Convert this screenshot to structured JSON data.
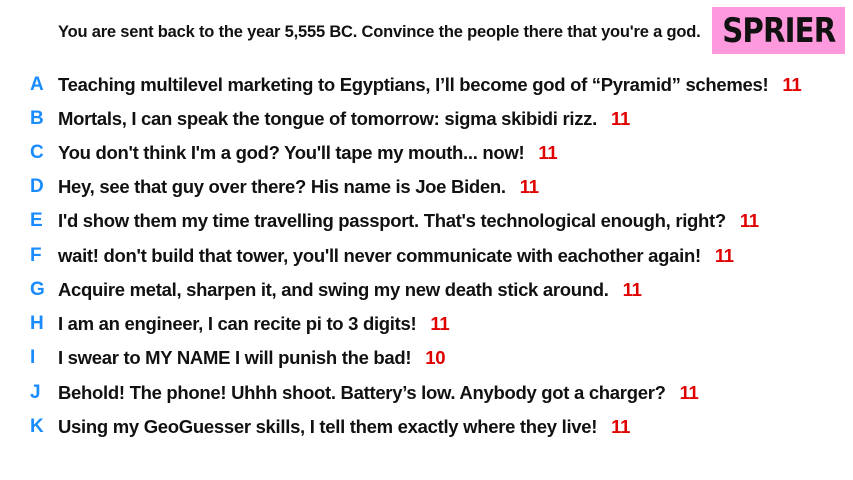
{
  "prompt": "You are sent back to the year 5,555 BC. Convince the people there that you're a god.",
  "badge": "SPRIER",
  "answers": [
    {
      "letter": "A",
      "text": "Teaching multilevel marketing to Egyptians, I’ll become god of “Pyramid” schemes!",
      "score": "11"
    },
    {
      "letter": "B",
      "text": "Mortals, I can speak the tongue of tomorrow: sigma skibidi rizz.",
      "score": "11"
    },
    {
      "letter": "C",
      "text": "You don't think I'm a god? You'll tape my mouth... now!",
      "score": "11"
    },
    {
      "letter": "D",
      "text": "Hey, see that guy over there? His name is Joe Biden.",
      "score": "11"
    },
    {
      "letter": "E",
      "text": "I'd show them my time travelling passport. That's technological enough, right?",
      "score": "11"
    },
    {
      "letter": "F",
      "text": "wait! don't build that tower, you'll never communicate with eachother again!",
      "score": "11"
    },
    {
      "letter": "G",
      "text": "Acquire metal, sharpen it, and swing my new death stick around.",
      "score": "11"
    },
    {
      "letter": "H",
      "text": "I am an engineer, I can recite pi to 3 digits!",
      "score": "11"
    },
    {
      "letter": "I",
      "text": "I swear to MY NAME I will punish the bad!",
      "score": "10"
    },
    {
      "letter": "J",
      "text": "Behold! The phone! Uhhh shoot. Battery’s low. Anybody got a charger?",
      "score": "11"
    },
    {
      "letter": "K",
      "text": "Using my GeoGuesser skills, I tell them exactly where they live!",
      "score": "11"
    }
  ],
  "colors": {
    "letter": "#1a8cff",
    "score": "#e00000",
    "badge_bg": "#ff99dd"
  }
}
